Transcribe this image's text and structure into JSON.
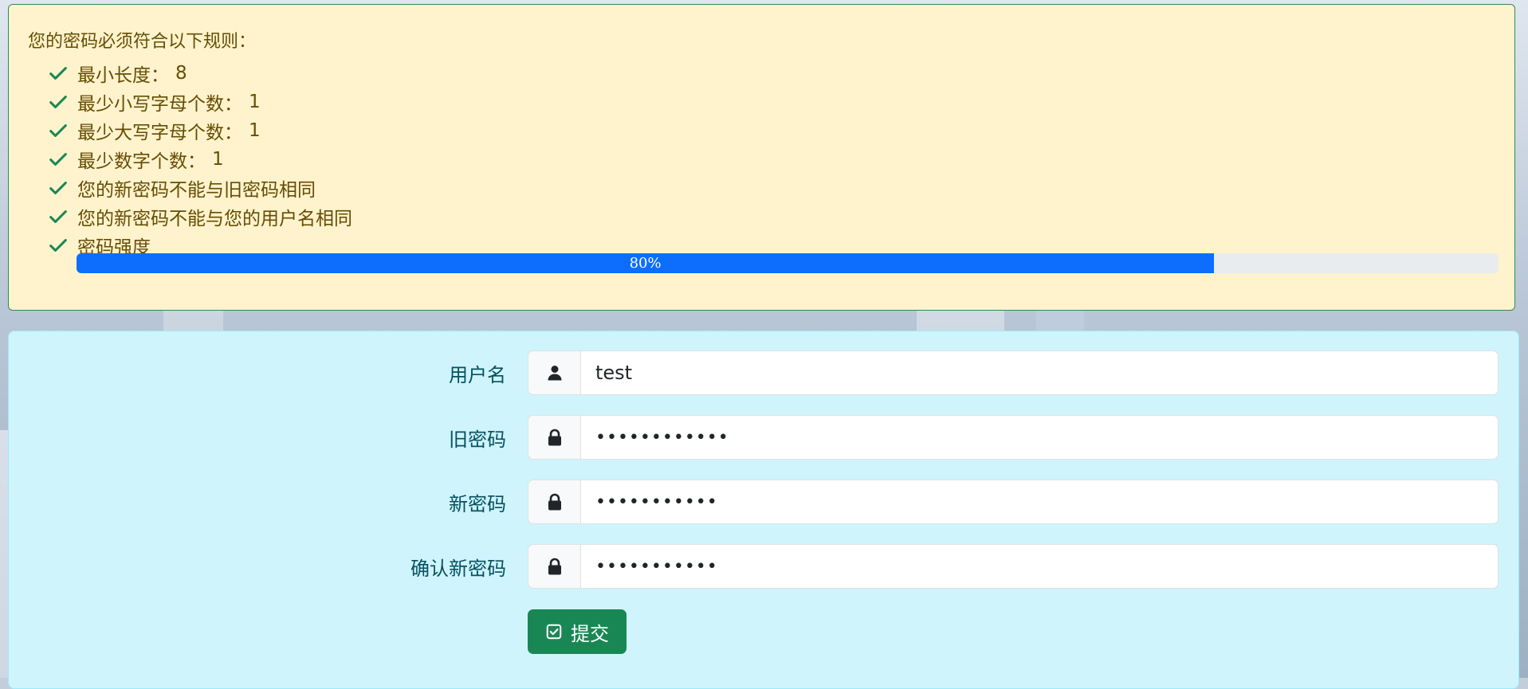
{
  "rules": {
    "title": "您的密码必须符合以下规则：",
    "items": [
      {
        "label": "最小长度：",
        "value": "8",
        "icon": "check-icon"
      },
      {
        "label": "最少小写字母个数：",
        "value": "1",
        "icon": "check-icon"
      },
      {
        "label": "最少大写字母个数：",
        "value": "1",
        "icon": "check-icon"
      },
      {
        "label": "最少数字个数：",
        "value": "1",
        "icon": "check-icon"
      },
      {
        "label": "您的新密码不能与旧密码相同",
        "value": "",
        "icon": "check-icon"
      },
      {
        "label": "您的新密码不能与您的用户名相同",
        "value": "",
        "icon": "check-icon"
      },
      {
        "label": "密码强度",
        "value": "",
        "icon": "check-icon"
      }
    ],
    "strength": {
      "percent": 80,
      "label": "80%"
    }
  },
  "form": {
    "username": {
      "label": "用户名",
      "value": "test",
      "icon": "user-icon"
    },
    "old_password": {
      "label": "旧密码",
      "value": "••••••••••••",
      "icon": "lock-icon"
    },
    "new_password": {
      "label": "新密码",
      "value": "•••••••••••",
      "icon": "lock-icon"
    },
    "confirm_password": {
      "label": "确认新密码",
      "value": "•••••••••••",
      "icon": "lock-icon"
    },
    "submit": {
      "label": "提交",
      "icon": "check-square-icon"
    }
  },
  "colors": {
    "rules_bg": "#fff3cd",
    "rules_text": "#664d03",
    "check": "#198754",
    "progress": "#0d6efd",
    "form_bg": "#cff4fc",
    "form_text": "#055160",
    "submit_bg": "#198754"
  }
}
